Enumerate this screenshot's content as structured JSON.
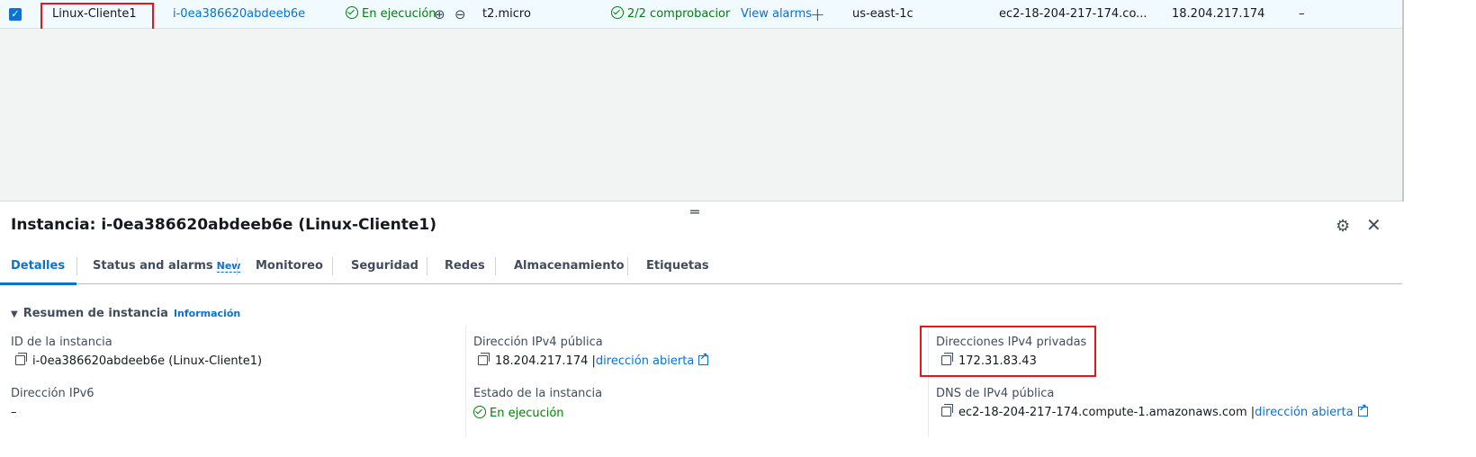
{
  "instance_row": {
    "checked": true,
    "name": "Linux-Cliente1",
    "instance_id": "i-0ea386620abdeeb6e",
    "state": "En ejecución",
    "instance_type": "t2.micro",
    "status_check": "2/2 comprobacior",
    "alarm_link": "View alarms",
    "availability_zone": "us-east-1c",
    "public_dns": "ec2-18-204-217-174.co...",
    "public_ipv4": "18.204.217.174",
    "extra": "–"
  },
  "detail": {
    "title": "Instancia: i-0ea386620abdeeb6e (Linux-Cliente1)",
    "tabs": [
      {
        "label": "Detalles",
        "active": true
      },
      {
        "label": "Status and alarms",
        "badge": "New"
      },
      {
        "label": "Monitoreo"
      },
      {
        "label": "Seguridad"
      },
      {
        "label": "Redes"
      },
      {
        "label": "Almacenamiento"
      },
      {
        "label": "Etiquetas"
      }
    ],
    "section_title": "Resumen de instancia",
    "section_info": "Información",
    "fields": {
      "instance_id_label": "ID de la instancia",
      "instance_id_value": "i-0ea386620abdeeb6e (Linux-Cliente1)",
      "public_ipv4_label": "Dirección IPv4 pública",
      "public_ipv4_value": "18.204.217.174",
      "open_address": "dirección abierta",
      "private_ipv4_label": "Direcciones IPv4 privadas",
      "private_ipv4_value": "172.31.83.43",
      "ipv6_label": "Dirección IPv6",
      "ipv6_value": "–",
      "state_label": "Estado de la instancia",
      "state_value": "En ejecución",
      "public_dns_label": "DNS de IPv4 pública",
      "public_dns_value": "ec2-18-204-217-174.compute-1.amazonaws.com",
      "open_address_2": "dirección abierta"
    }
  },
  "colors": {
    "accent": "#0972d3",
    "success": "#037f0c",
    "highlight": "#e6141c",
    "selected_row_bg": "#f1faff"
  },
  "icons": [
    "checkbox-checked-icon",
    "status-ok-icon",
    "zoom-in-icon",
    "zoom-out-icon",
    "plus-icon",
    "drag-handle-icon",
    "gear-icon",
    "close-icon",
    "caret-down-icon",
    "copy-icon",
    "external-link-icon"
  ]
}
